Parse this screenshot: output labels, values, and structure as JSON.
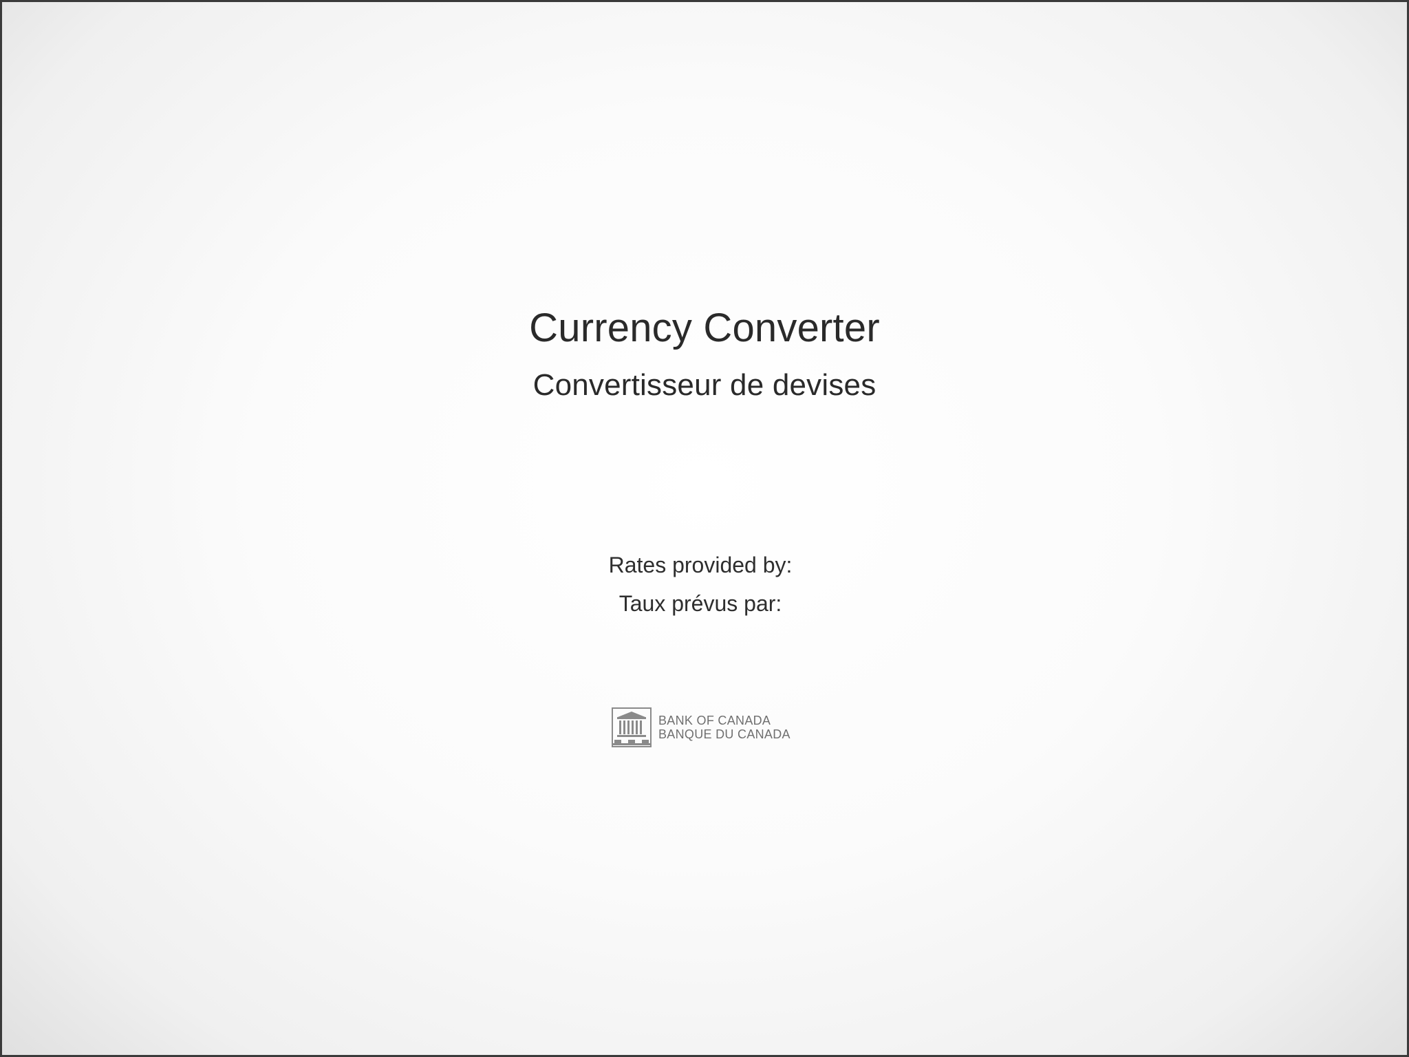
{
  "app": {
    "title_en": "Currency Converter",
    "title_fr": "Convertisseur de devises"
  },
  "attribution": {
    "label_en": "Rates provided by:",
    "label_fr": "Taux prévus par:"
  },
  "logo": {
    "icon": "bank-building-icon",
    "line1": "BANK OF CANADA",
    "line2": "BANQUE DU CANADA"
  },
  "colors": {
    "text": "#2a2a2a",
    "logo": "#6f6f6f",
    "frame": "#3a3a3a"
  }
}
